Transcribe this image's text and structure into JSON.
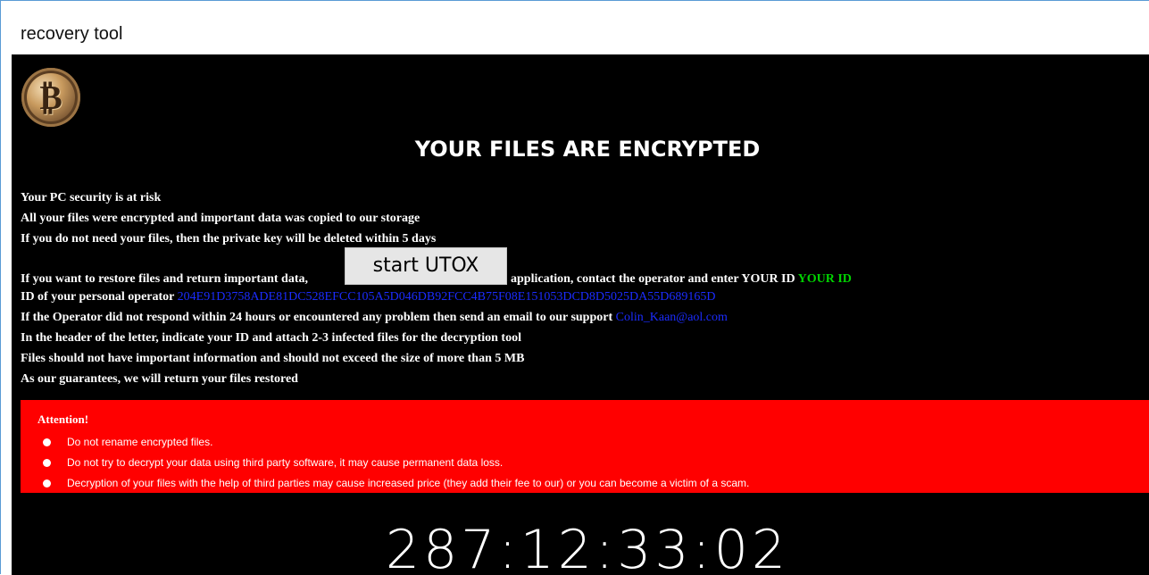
{
  "window": {
    "title": "recovery tool"
  },
  "logo": {
    "icon": "bitcoin-coin-icon",
    "glyph": "₿"
  },
  "headline": "YOUR FILES ARE ENCRYPTED",
  "lines": {
    "security": "Your PC security is at risk",
    "copied": "All your files were encrypted and important data was copied to our storage",
    "deleted": "If you do not need your files, then the private key will be deleted within 5 days",
    "restore_before": "If you want to restore files and return important data,",
    "restore_after": "application, contact the operator and enter YOUR ID",
    "your_id_value": "YOUR ID",
    "operator_label": "ID of your personal operator",
    "operator_id": "204E91D3758ADE81DC528EFCC105A5D046DB92FCC4B75F08E151053DCD8D5025DA55D689165D",
    "no_response": "If the Operator did not respond within 24 hours or encountered any problem then send an email to our support",
    "support_email": "Colin_Kaan@aol.com",
    "header_instruction": "In the header of the letter, indicate your ID and attach 2-3 infected files for the decryption tool",
    "size_limit": "Files should not have important information and should not exceed the size of more than 5 MB",
    "guarantee": "As our guarantees, we will return your files restored"
  },
  "utox_button": {
    "label": "start UTOX"
  },
  "attention": {
    "title": "Attention!",
    "items": [
      "Do not rename encrypted files.",
      "Do not try to decrypt your data using third party software, it may cause permanent data loss.",
      "Decryption of your files with the help of third parties may cause increased price (they add their fee to our) or you can become a victim of a scam."
    ]
  },
  "countdown": "287:12:33:02",
  "colors": {
    "background": "#000000",
    "attention_bg": "#ff0000",
    "id_green": "#00d400",
    "link_blue": "#1b2cff"
  }
}
